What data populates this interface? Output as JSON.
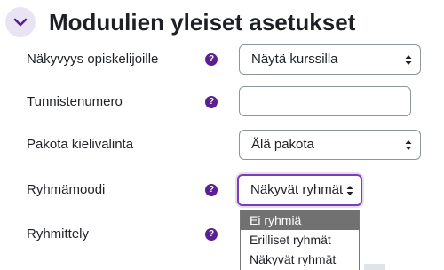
{
  "section": {
    "title": "Moduulien yleiset asetukset"
  },
  "help": {
    "glyph": "?"
  },
  "fields": {
    "visibility": {
      "label": "Näkyvyys opiskelijoille",
      "value": "Näytä kurssilla"
    },
    "idnumber": {
      "label": "Tunnistenumero",
      "value": ""
    },
    "language": {
      "label": "Pakota kielivalinta",
      "value": "Älä pakota"
    },
    "groupmode": {
      "label": "Ryhmämoodi",
      "value": "Näkyvät ryhmät",
      "options": [
        "Ei ryhmiä",
        "Erilliset ryhmät",
        "Näkyvät ryhmät"
      ],
      "highlighted_option": "Ei ryhmiä"
    },
    "grouping": {
      "label": "Ryhmittely"
    }
  },
  "colors": {
    "accent": "#5b1f8f",
    "focus_border": "#7a3fb5",
    "collapse_bg": "#e9e4f3",
    "option_highlight": "#717171"
  },
  "icons": {
    "collapse": "chevron-down-icon",
    "help": "question-circle-icon",
    "select": "up-down-arrows-icon"
  }
}
